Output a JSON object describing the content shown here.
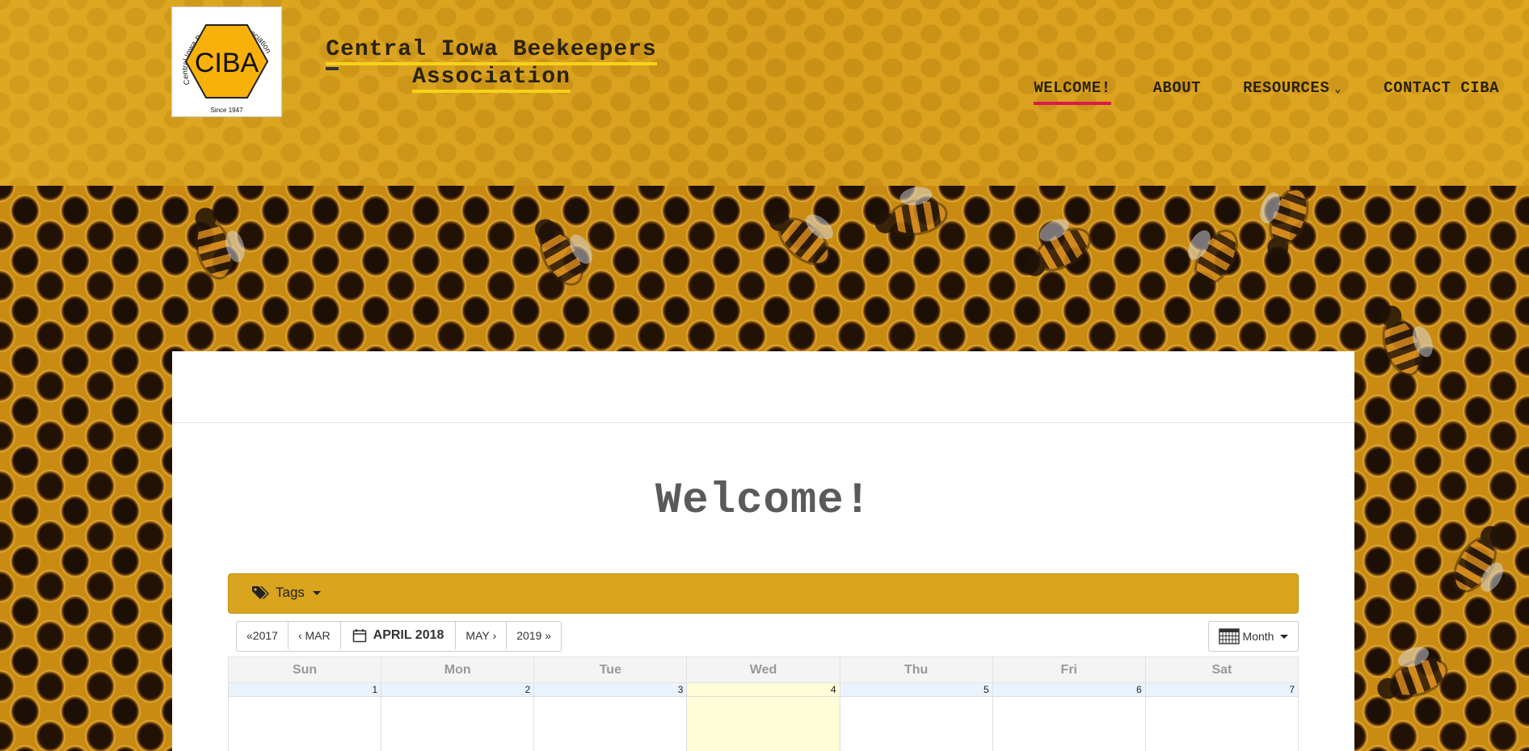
{
  "header": {
    "logo": {
      "text": "CIBA",
      "ring_text": "Central Iowa Beekeepers Association",
      "since": "Since 1947"
    },
    "site_title_line1": "Central Iowa Beekeepers",
    "site_title_line2": "Association",
    "nav": [
      {
        "label": "WELCOME!",
        "active": true
      },
      {
        "label": "ABOUT",
        "active": false
      },
      {
        "label": "RESOURCES",
        "active": false,
        "has_dropdown": true
      },
      {
        "label": "CONTACT CIBA",
        "active": false
      }
    ]
  },
  "page": {
    "title": "Welcome!"
  },
  "calendar": {
    "tags_label": "Tags",
    "prev_year": "2017",
    "prev_month": "MAR",
    "current": "APRIL 2018",
    "next_month": "MAY",
    "next_year": "2019",
    "view_label": "Month",
    "weekdays": [
      "Sun",
      "Mon",
      "Tue",
      "Wed",
      "Thu",
      "Fri",
      "Sat"
    ],
    "first_week": [
      "1",
      "2",
      "3",
      "4",
      "5",
      "6",
      "7"
    ],
    "today_index": 3
  },
  "colors": {
    "header_bg": "#dba21f",
    "accent_underline": "#d81b4c",
    "title_underline": "#f7d21a",
    "tag_bar": "#d9a41e",
    "today_bg": "#fffcd8"
  }
}
